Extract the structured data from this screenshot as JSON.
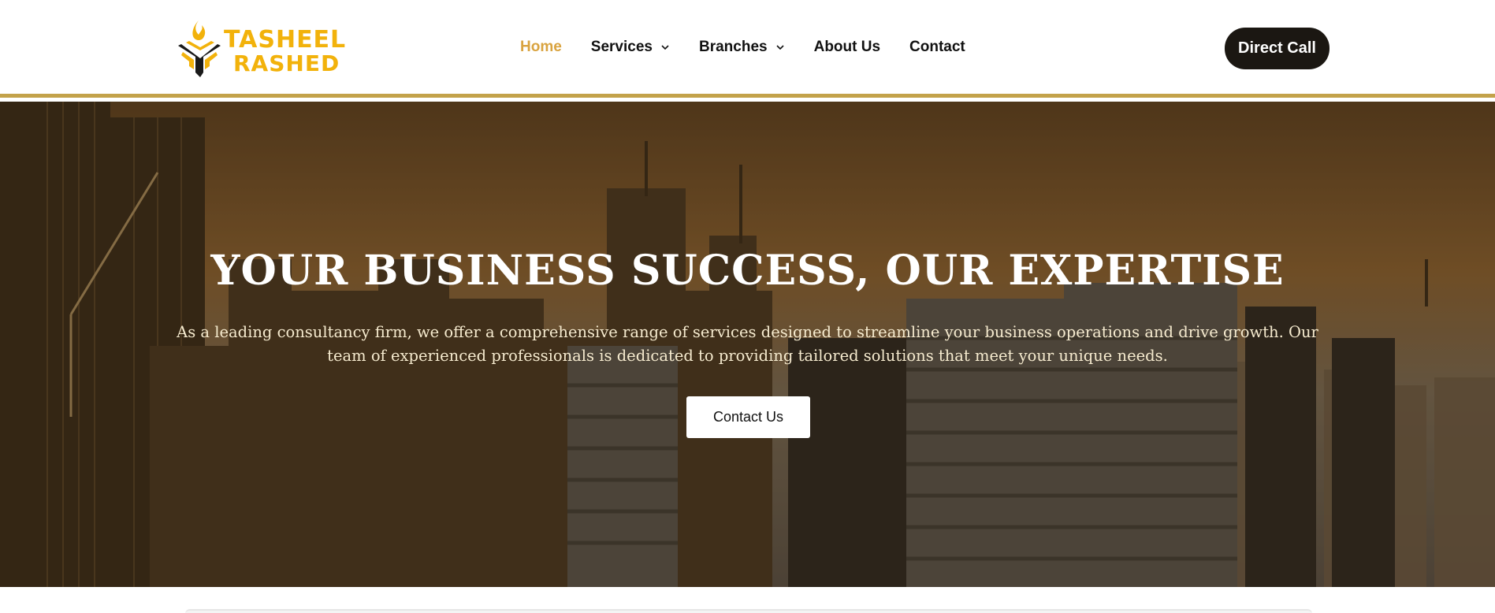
{
  "brand": {
    "logo_line1": "TASHEEL",
    "logo_line2": "RASHED",
    "primary_color": "#f2b20b",
    "accent_border_color": "#c3a24a"
  },
  "nav": {
    "items": [
      {
        "label": "Home",
        "active": true
      },
      {
        "label": "Services",
        "has_dropdown": true,
        "icon": "chevron-down-icon"
      },
      {
        "label": "Branches",
        "has_dropdown": true,
        "icon": "chevron-down-icon"
      },
      {
        "label": "About Us"
      },
      {
        "label": "Contact"
      }
    ],
    "active_color": "#d9a33f"
  },
  "header": {
    "cta_label": "Direct Call"
  },
  "hero": {
    "title": "YOUR BUSINESS SUCCESS, OUR EXPERTISE",
    "description": "As a leading consultancy firm, we offer a comprehensive range of services designed to streamline your business operations and drive growth. Our team of experienced professionals is dedicated to providing tailored solutions that meet your unique needs.",
    "button_label": "Contact Us"
  }
}
